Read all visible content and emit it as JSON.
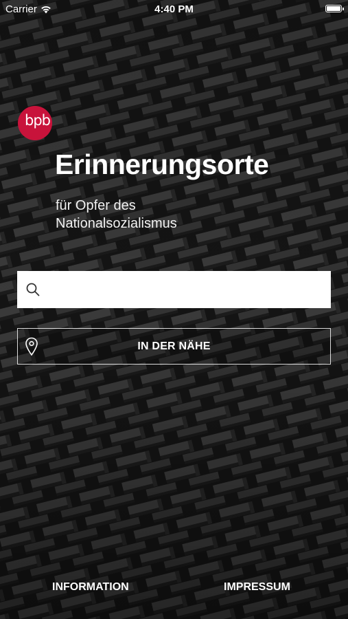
{
  "status_bar": {
    "carrier": "Carrier",
    "time": "4:40 PM",
    "battery_level": 1.0
  },
  "logo": {
    "text": "bpb",
    "color": "#c8133b"
  },
  "header": {
    "title": "Erinnerungsorte",
    "subtitle_line1": "für Opfer des",
    "subtitle_line2": "Nationalsozialismus"
  },
  "search": {
    "placeholder": "",
    "value": "",
    "icon": "search-icon"
  },
  "nearby_button": {
    "label": "IN DER NÄHE",
    "icon": "map-pin-icon"
  },
  "footer": {
    "information_label": "INFORMATION",
    "impressum_label": "IMPRESSUM"
  },
  "colors": {
    "accent": "#c8133b",
    "background": "#121212",
    "text": "#ffffff"
  }
}
